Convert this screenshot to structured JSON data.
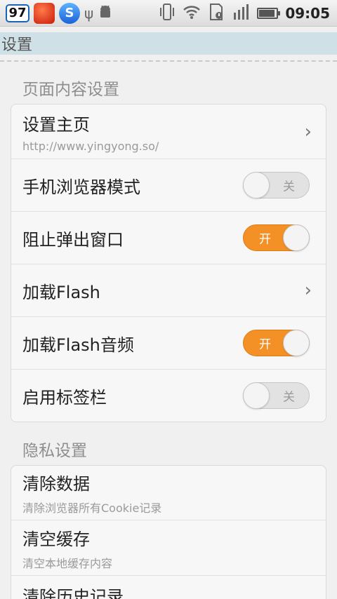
{
  "status_bar": {
    "badge": "97",
    "app2": "",
    "app3": "S",
    "icons": [
      "usb-icon",
      "android-icon",
      "vibrate-icon",
      "wifi-icon",
      "sd-card-alert-icon",
      "signal-icon",
      "battery-icon"
    ],
    "time": "09:05"
  },
  "header": {
    "title": "设置"
  },
  "sections": [
    {
      "title": "页面内容设置",
      "items": [
        {
          "title": "设置主页",
          "sub": "http://www.yingyong.so/",
          "control": "chevron"
        },
        {
          "title": "手机浏览器模式",
          "control": "toggle",
          "state": "关"
        },
        {
          "title": "阻止弹出窗口",
          "control": "toggle",
          "state": "开"
        },
        {
          "title": "加载Flash",
          "control": "chevron"
        },
        {
          "title": "加载Flash音频",
          "control": "toggle",
          "state": "开"
        },
        {
          "title": "启用标签栏",
          "control": "toggle",
          "state": "关"
        }
      ]
    },
    {
      "title": "隐私设置",
      "items": [
        {
          "title": "清除数据",
          "sub": "清除浏览器所有Cookie记录"
        },
        {
          "title": "清空缓存",
          "sub": "清空本地缓存内容"
        },
        {
          "title": "清除历史记录"
        }
      ]
    }
  ],
  "colors": {
    "toggle_on": "#f39126",
    "toggle_off": "#e2e2e2",
    "titlebar": "#cfe1e6"
  }
}
